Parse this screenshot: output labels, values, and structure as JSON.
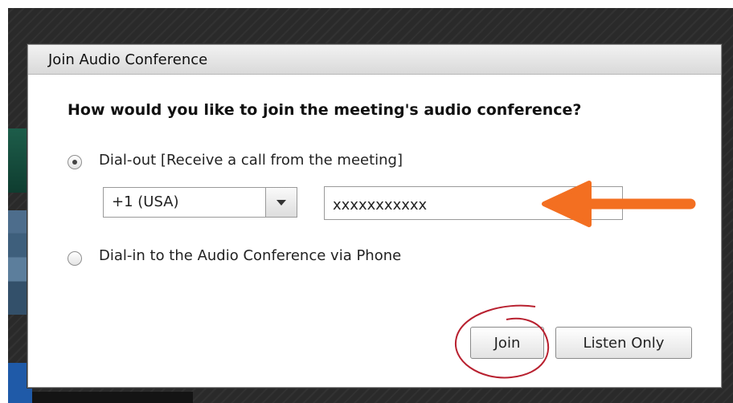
{
  "dialog": {
    "title": "Join Audio Conference",
    "question": "How would you like to join the meeting's audio conference?",
    "options": [
      {
        "label": "Dial-out [Receive a call from the meeting]",
        "selected": true
      },
      {
        "label": "Dial-in to the Audio Conference via Phone",
        "selected": false
      }
    ],
    "country_select": {
      "value": "+1 (USA)"
    },
    "phone_input": {
      "value": "xxxxxxxxxxx"
    },
    "buttons": {
      "join": "Join",
      "listen_only": "Listen Only"
    }
  },
  "annotations": {
    "arrow_color": "#f36f21",
    "circle_color": "#b8202f"
  }
}
